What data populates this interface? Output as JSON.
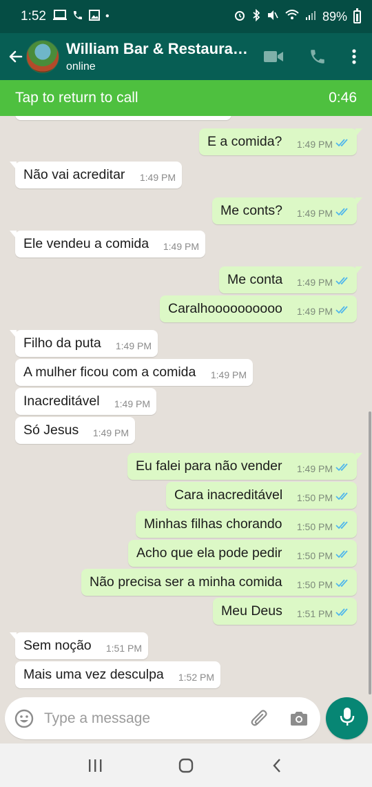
{
  "status_bar": {
    "time": "1:52",
    "battery": "89%"
  },
  "header": {
    "contact_name": "William Bar & Restaura…",
    "contact_status": "online",
    "icons": [
      "back-arrow-icon",
      "videocam-icon",
      "phone-icon",
      "more-vert-icon"
    ]
  },
  "call_banner": {
    "label": "Tap to return to call",
    "duration": "0:46"
  },
  "messages": [
    {
      "dir": "out",
      "text": "E a comida?",
      "time": "1:49 PM"
    },
    {
      "dir": "in",
      "text": "Não vai acreditar",
      "time": "1:49 PM"
    },
    {
      "dir": "out",
      "text": "Me conts?",
      "time": "1:49 PM"
    },
    {
      "dir": "in",
      "text": "Ele vendeu a comida",
      "time": "1:49 PM"
    },
    {
      "dir": "out",
      "text": "Me conta",
      "time": "1:49 PM"
    },
    {
      "dir": "out",
      "text": "Caralhoooooooooo",
      "time": "1:49 PM"
    },
    {
      "dir": "in",
      "text": "Filho da puta",
      "time": "1:49 PM"
    },
    {
      "dir": "in",
      "text": "A mulher ficou com a comida",
      "time": "1:49 PM"
    },
    {
      "dir": "in",
      "text": "Inacreditável",
      "time": "1:49 PM"
    },
    {
      "dir": "in",
      "text": "Só Jesus",
      "time": "1:49 PM"
    },
    {
      "dir": "out",
      "text": "Eu falei para não vender",
      "time": "1:49 PM"
    },
    {
      "dir": "out",
      "text": "Cara inacreditável",
      "time": "1:50 PM"
    },
    {
      "dir": "out",
      "text": "Minhas filhas chorando",
      "time": "1:50 PM"
    },
    {
      "dir": "out",
      "text": "Acho que ela pode pedir",
      "time": "1:50 PM"
    },
    {
      "dir": "out",
      "text": "Não precisa ser a minha comida",
      "time": "1:50 PM"
    },
    {
      "dir": "out",
      "text": "Meu Deus",
      "time": "1:51 PM"
    },
    {
      "dir": "in",
      "text": "Sem noção",
      "time": "1:51 PM"
    },
    {
      "dir": "in",
      "text": "Mais uma vez desculpa",
      "time": "1:52 PM"
    }
  ],
  "composer": {
    "placeholder": "Type a message"
  },
  "colors": {
    "header": "#075e54",
    "status_bar": "#054d44",
    "call_banner": "#4ec03f",
    "outgoing_bubble": "#dcf8c6",
    "incoming_bubble": "#ffffff",
    "read_ticks": "#4fb6ec",
    "send_button": "#078674"
  }
}
